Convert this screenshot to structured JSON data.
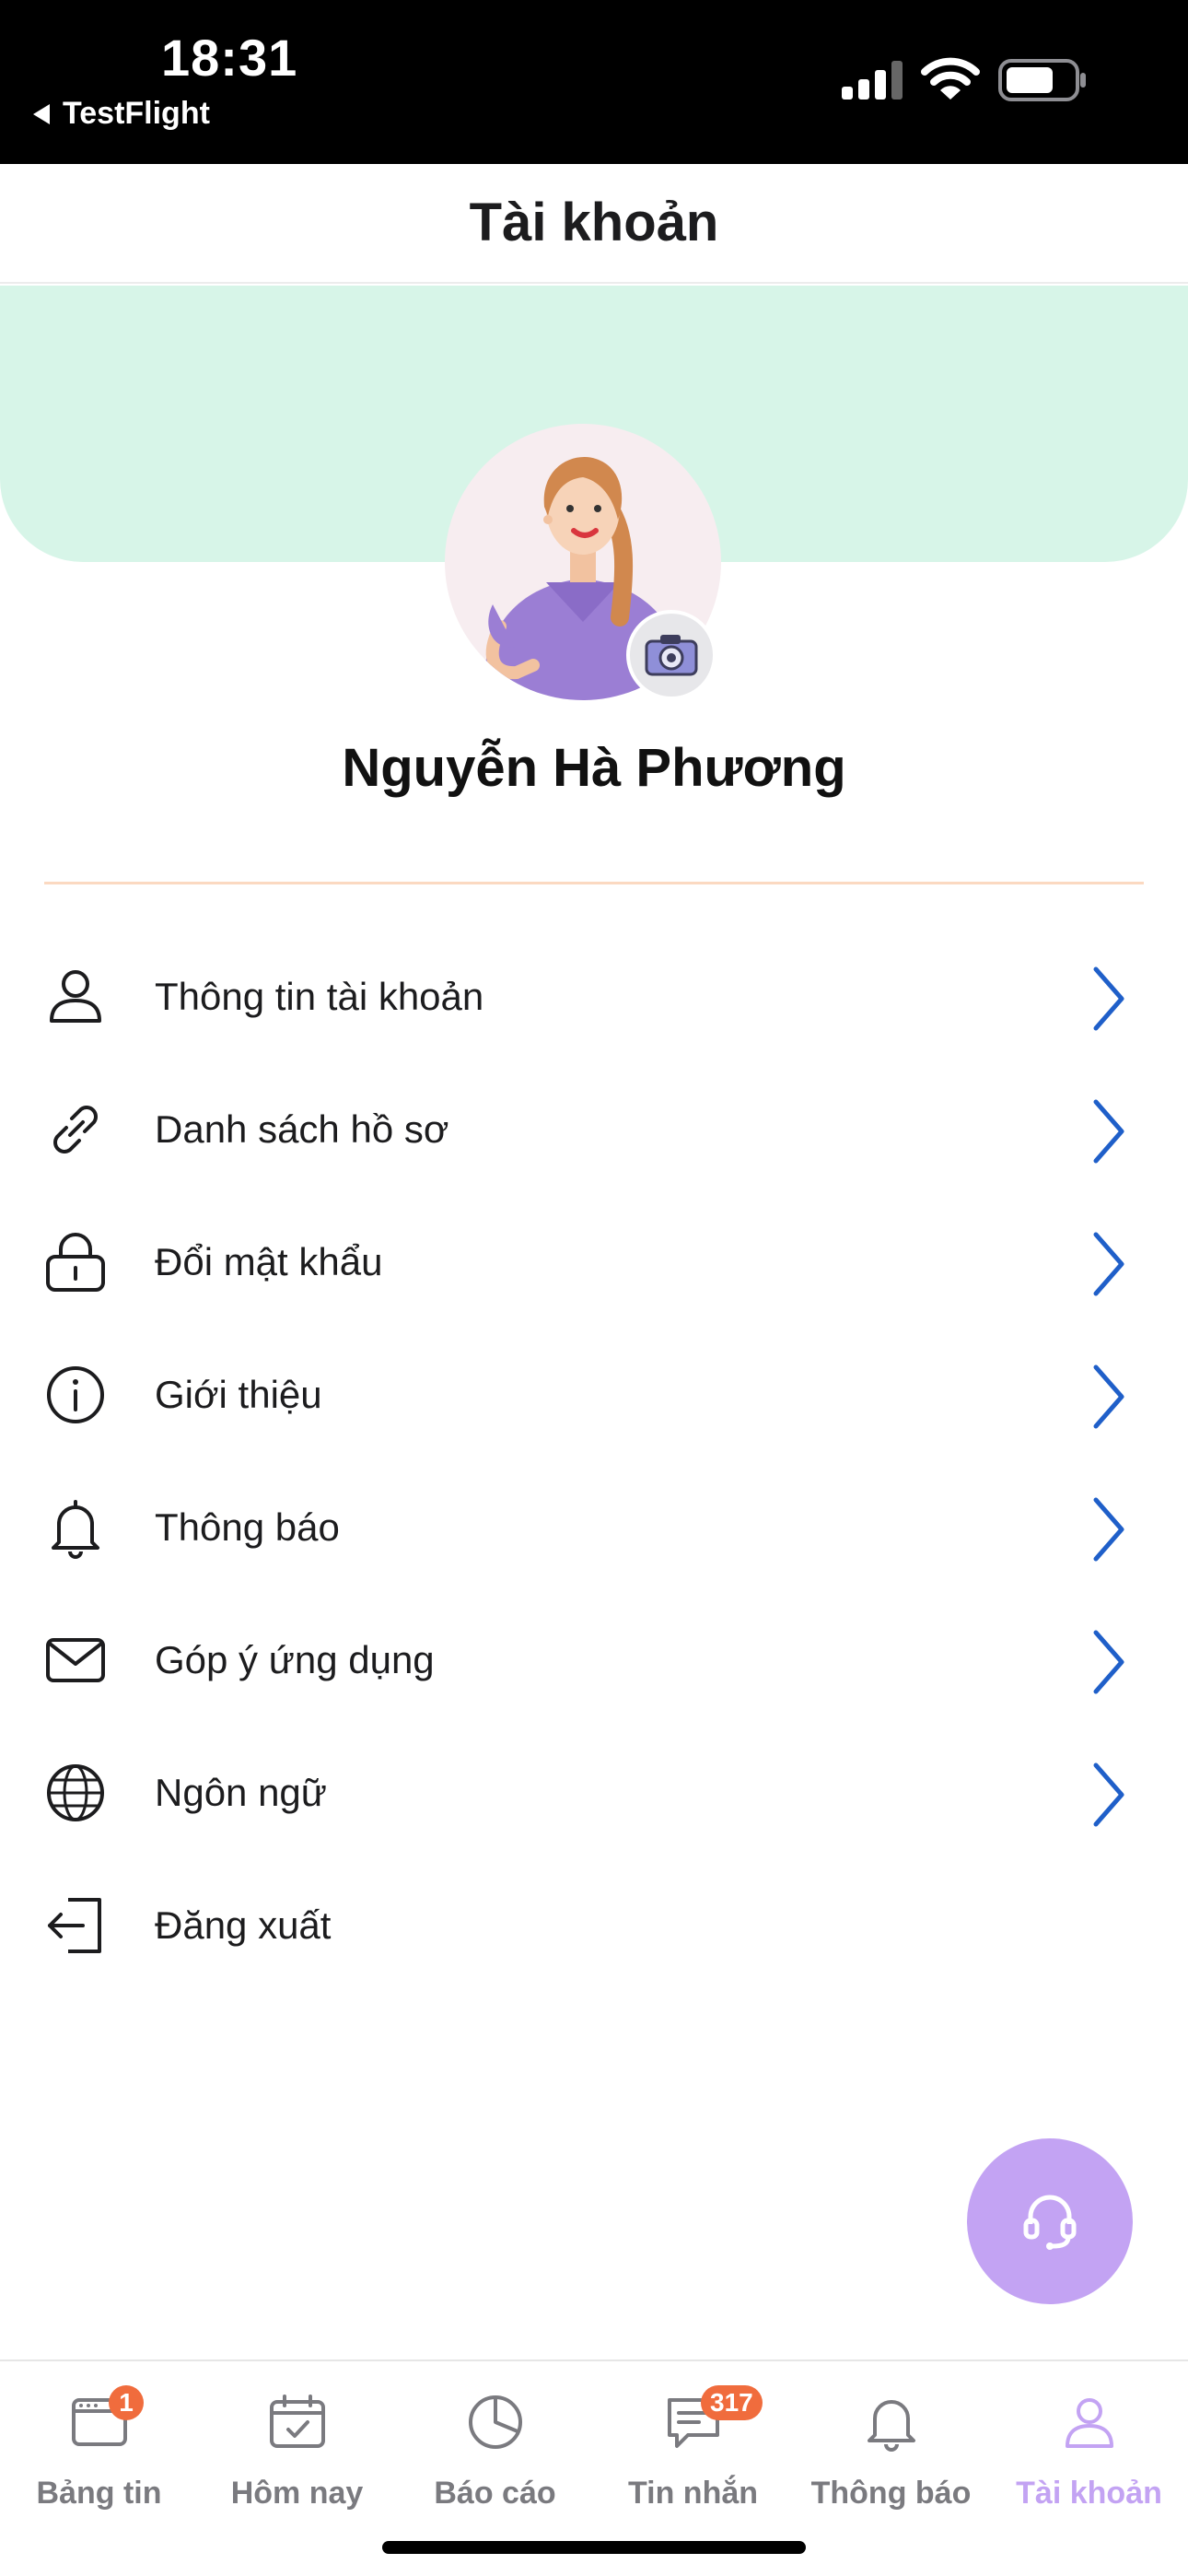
{
  "status_bar": {
    "time": "18:31",
    "back_app": "TestFlight"
  },
  "header": {
    "title": "Tài khoản"
  },
  "profile": {
    "name": "Nguyễn Hà Phương"
  },
  "menu": {
    "items": [
      {
        "label": "Thông tin tài khoản",
        "icon": "user-icon"
      },
      {
        "label": "Danh sách hồ sơ",
        "icon": "link-icon"
      },
      {
        "label": "Đổi mật khẩu",
        "icon": "lock-icon"
      },
      {
        "label": "Giới thiệu",
        "icon": "info-icon"
      },
      {
        "label": "Thông báo",
        "icon": "bell-icon"
      },
      {
        "label": "Góp ý ứng dụng",
        "icon": "mail-icon"
      },
      {
        "label": "Ngôn ngữ",
        "icon": "globe-icon"
      },
      {
        "label": "Đăng xuất",
        "icon": "logout-icon"
      }
    ]
  },
  "tab_bar": {
    "tabs": [
      {
        "label": "Bảng tin",
        "icon": "news-icon",
        "badge": "1"
      },
      {
        "label": "Hôm nay",
        "icon": "calendar-check-icon"
      },
      {
        "label": "Báo cáo",
        "icon": "pie-chart-icon"
      },
      {
        "label": "Tin nhắn",
        "icon": "message-icon",
        "badge": "317"
      },
      {
        "label": "Thông báo",
        "icon": "bell-icon"
      },
      {
        "label": "Tài khoản",
        "icon": "user-icon",
        "active": true
      }
    ]
  },
  "colors": {
    "accent": "#c3a3f3",
    "hero_background": "#d7f5e8",
    "chevron": "#1f5fc9",
    "badge": "#f06c3d",
    "divider": "#fbd9c1"
  }
}
